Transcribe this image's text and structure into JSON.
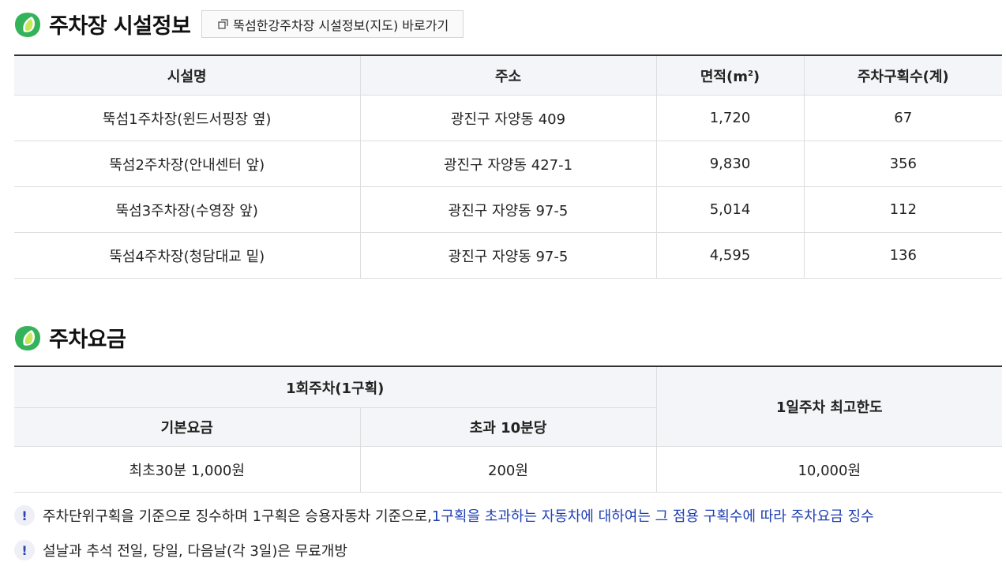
{
  "facility_section": {
    "title": "주차장 시설정보",
    "map_link": "뚝섬한강주차장 시설정보(지도) 바로가기",
    "headers": [
      "시설명",
      "주소",
      "면적(m",
      "주차구획수(계)"
    ],
    "area_unit_sup": "2",
    "area_unit_close": ")",
    "rows": [
      {
        "name": "뚝섬1주차장(윈드서핑장 옆)",
        "address": "광진구 자양동 409",
        "area": "1,720",
        "spaces": "67"
      },
      {
        "name": "뚝섬2주차장(안내센터 앞)",
        "address": "광진구 자양동 427-1",
        "area": "9,830",
        "spaces": "356"
      },
      {
        "name": "뚝섬3주차장(수영장 앞)",
        "address": "광진구 자양동 97-5",
        "area": "5,014",
        "spaces": "112"
      },
      {
        "name": "뚝섬4주차장(청담대교 밑)",
        "address": "광진구 자양동 97-5",
        "area": "4,595",
        "spaces": "136"
      }
    ]
  },
  "fee_section": {
    "title": "주차요금",
    "group_header": "1회주차(1구획)",
    "daily_max_header": "1일주차 최고한도",
    "sub_headers": [
      "기본요금",
      "초과 10분당"
    ],
    "values": {
      "basic": "최초30분 1,000원",
      "extra": "200원",
      "daily_max": "10,000원"
    }
  },
  "notes": [
    {
      "text": "주차단위구획을 기준으로 징수하며 1구획은 승용자동차 기준으로, ",
      "highlight": "1구획을 초과하는 자동차에 대하여는 그 점용 구획수에 따라 주차요금 징수"
    },
    {
      "text": "설날과 추석 전일, 당일, 다음날(각 3일)은 무료개방",
      "highlight": ""
    }
  ],
  "icons": {
    "section": "leaf-icon",
    "link": "external-link-icon",
    "note": "exclamation-icon"
  },
  "colors": {
    "leaf_outer": "#35b35b",
    "leaf_inner": "#c7e85a",
    "note_highlight": "#1e3fb3",
    "header_bg": "#f4f5f8"
  }
}
